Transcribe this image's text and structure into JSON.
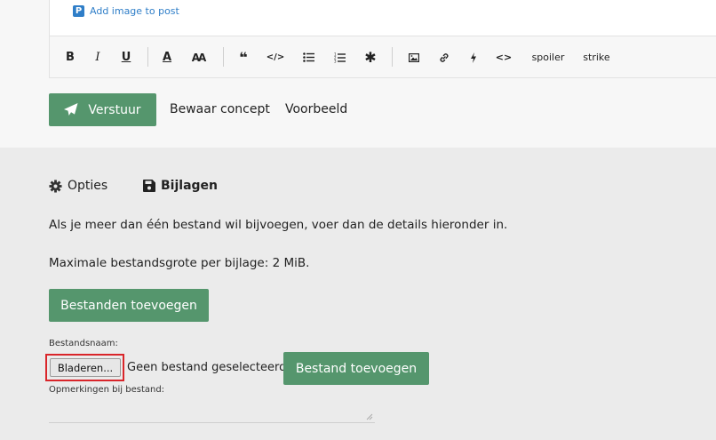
{
  "editor": {
    "add_image_label": "Add image to post",
    "add_image_icon": "p-logo-icon"
  },
  "toolbar": {
    "bold": "B",
    "italic": "I",
    "underline": "U",
    "font_color": "A",
    "font_size": "AA",
    "quote": "❝",
    "code": "</>",
    "bullet_list": "bullet-list-icon",
    "numbered_list": "numbered-list-icon",
    "asterisk": "✱",
    "image": "image-icon",
    "link": "link-icon",
    "flash": "bolt-icon",
    "html": "<>",
    "spoiler": "spoiler",
    "strike": "strike"
  },
  "actions": {
    "send_label": "Verstuur",
    "save_draft_label": "Bewaar concept",
    "preview_label": "Voorbeeld"
  },
  "tabs": [
    {
      "label": "Opties",
      "icon": "gear-icon",
      "active": false
    },
    {
      "label": "Bijlagen",
      "icon": "floppy-disk-icon",
      "active": true
    }
  ],
  "attachments": {
    "intro": "Als je meer dan één bestand wil bijvoegen, voer dan de details hieronder in.",
    "max_size": "Maximale bestandsgrote per bijlage: 2 MiB.",
    "add_files_label": "Bestanden toevoegen",
    "filename_label": "Bestandsnaam:",
    "browse_label": "Bladeren...",
    "no_file_text": "Geen bestand geselecteerd.",
    "add_file_label": "Bestand toevoegen",
    "remarks_label": "Opmerkingen bij bestand:"
  },
  "colors": {
    "accent_green": "#55966d",
    "link_blue": "#2f7ec8",
    "highlight_red": "#d9252a"
  }
}
